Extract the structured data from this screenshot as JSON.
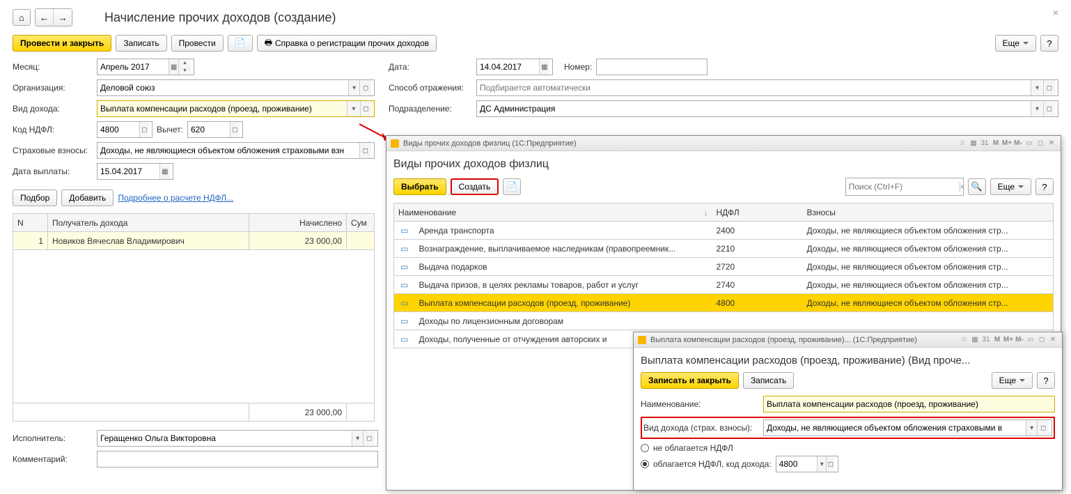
{
  "main": {
    "title": "Начисление прочих доходов (создание)",
    "toolbar": {
      "post_close": "Провести и закрыть",
      "write": "Записать",
      "post": "Провести",
      "print_ref": "Справка о регистрации прочих доходов",
      "more": "Еще"
    },
    "fields": {
      "month_label": "Месяц:",
      "month_value": "Апрель 2017",
      "date_label": "Дата:",
      "date_value": "14.04.2017",
      "number_label": "Номер:",
      "number_value": "",
      "org_label": "Организация:",
      "org_value": "Деловой союз",
      "reflect_label": "Способ отражения:",
      "reflect_placeholder": "Подбирается автоматически",
      "income_label": "Вид дохода:",
      "income_value": "Выплата компенсации расходов (проезд, проживание)",
      "dept_label": "Подразделение:",
      "dept_value": "ДС Администрация",
      "ndfl_label": "Код НДФЛ:",
      "ndfl_value": "4800",
      "deduct_label": "Вычет:",
      "deduct_value": "620",
      "contrib_label": "Страховые взносы:",
      "contrib_value": "Доходы, не являющиеся объектом обложения страховыми взн",
      "paydate_label": "Дата выплаты:",
      "paydate_value": "15.04.2017"
    },
    "subtoolbar": {
      "select": "Подбор",
      "add": "Добавить",
      "detail_link": "Подробнее о расчете НДФЛ..."
    },
    "table": {
      "cols": [
        "N",
        "Получатель дохода",
        "Начислено",
        "Сум"
      ],
      "rows": [
        {
          "n": "1",
          "recipient": "Новиков Вячеслав Владимирович",
          "accrued": "23 000,00",
          "sum": ""
        }
      ],
      "total": "23 000,00"
    },
    "footer": {
      "performer_label": "Исполнитель:",
      "performer_value": "Геращенко Ольга Викторовна",
      "comment_label": "Комментарий:",
      "comment_value": ""
    }
  },
  "dlg1": {
    "title_app": "Виды прочих доходов физлиц  (1С:Предприятие)",
    "title": "Виды прочих доходов физлиц",
    "toolbar": {
      "choose": "Выбрать",
      "create": "Создать",
      "more": "Еще"
    },
    "search_placeholder": "Поиск (Ctrl+F)",
    "cols": {
      "name": "Наименование",
      "ndfl": "НДФЛ",
      "contrib": "Взносы"
    },
    "rows": [
      {
        "name": "Аренда транспорта",
        "ndfl": "2400",
        "contrib": "Доходы, не являющиеся объектом обложения стр...",
        "sel": false
      },
      {
        "name": "Вознаграждение, выплачиваемое наследникам (правопреемник...",
        "ndfl": "2210",
        "contrib": "Доходы, не являющиеся объектом обложения стр...",
        "sel": false
      },
      {
        "name": "Выдача подарков",
        "ndfl": "2720",
        "contrib": "Доходы, не являющиеся объектом обложения стр...",
        "sel": false
      },
      {
        "name": "Выдача призов, в целях рекламы товаров, работ и услуг",
        "ndfl": "2740",
        "contrib": "Доходы, не являющиеся объектом обложения стр...",
        "sel": false
      },
      {
        "name": "Выплата компенсации расходов (проезд, проживание)",
        "ndfl": "4800",
        "contrib": "Доходы, не являющиеся объектом обложения стр...",
        "sel": true
      },
      {
        "name": "Доходы по лицензионным договорам",
        "ndfl": "",
        "contrib": "",
        "sel": false
      },
      {
        "name": "Доходы, полученные от отчуждения авторских и",
        "ndfl": "",
        "contrib": "",
        "sel": false
      }
    ]
  },
  "dlg2": {
    "title_app": "Выплата компенсации расходов (проезд, проживание)...  (1С:Предприятие)",
    "title": "Выплата компенсации расходов (проезд, проживание) (Вид проче...",
    "toolbar": {
      "write_close": "Записать и закрыть",
      "write": "Записать",
      "more": "Еще"
    },
    "name_label": "Наименование:",
    "name_value": "Выплата компенсации расходов (проезд, проживание)",
    "income_label": "Вид дохода (страх. взносы):",
    "income_value": "Доходы, не являющиеся объектом обложения страховыми в",
    "radio_no": "не облагается НДФЛ",
    "radio_yes": "облагается НДФЛ, код дохода:",
    "code_value": "4800"
  },
  "glyphs": {
    "home": "⌂",
    "left": "←",
    "right": "→",
    "cal": "📅",
    "print": "🖶",
    "open": "▣",
    "drop": "▾",
    "search": "🔍",
    "close": "✕",
    "refresh": "↻",
    "star": "☆"
  }
}
